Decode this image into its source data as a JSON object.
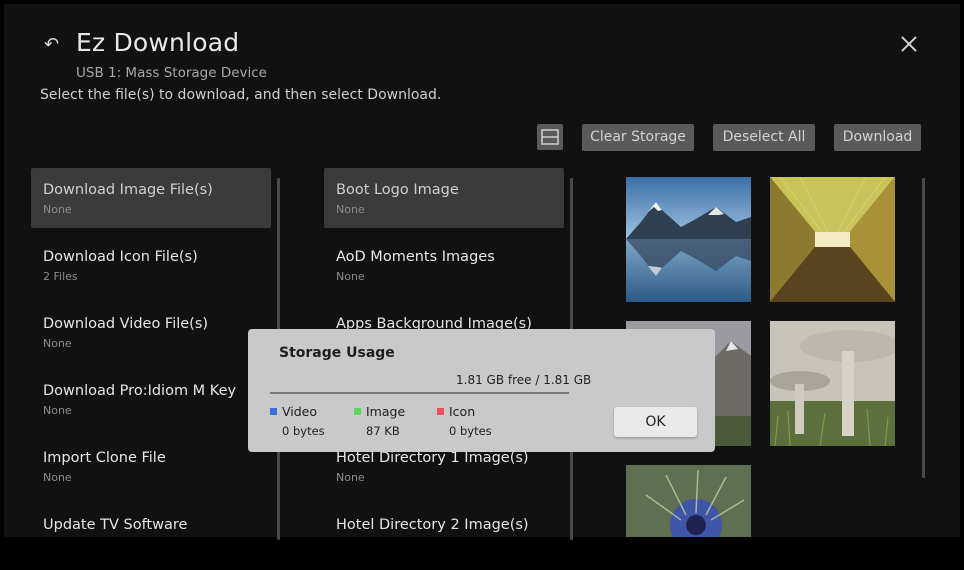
{
  "header": {
    "title": "Ez Download",
    "subtitle": "USB 1: Mass Storage Device",
    "instruction": "Select the file(s) to download, and then select Download."
  },
  "toolbar": {
    "clear_storage": "Clear Storage",
    "deselect_all": "Deselect All",
    "download": "Download"
  },
  "categories": [
    {
      "label": "Download Image File(s)",
      "sub": "None",
      "selected": true
    },
    {
      "label": "Download Icon File(s)",
      "sub": "2 Files"
    },
    {
      "label": "Download Video File(s)",
      "sub": "None"
    },
    {
      "label": "Download Pro:Idiom M Key",
      "sub": "None"
    },
    {
      "label": "Import Clone File",
      "sub": "None"
    },
    {
      "label": "Update TV Software",
      "sub": ""
    }
  ],
  "image_types": [
    {
      "label": "Boot Logo Image",
      "sub": "None",
      "selected": true
    },
    {
      "label": "AoD Moments Images",
      "sub": "None"
    },
    {
      "label": "Apps Background Image(s)",
      "sub": ""
    },
    {
      "label": "",
      "sub": ""
    },
    {
      "label": "Hotel Directory 1 Image(s)",
      "sub": "None"
    },
    {
      "label": "Hotel Directory 2 Image(s)",
      "sub": ""
    }
  ],
  "thumbnails": [
    {
      "name": "mountain-lake-thumbnail"
    },
    {
      "name": "tunnel-thumbnail"
    },
    {
      "name": "rocky-mountains-thumbnail"
    },
    {
      "name": "mushroom-thumbnail"
    },
    {
      "name": "flower-thumbnail"
    }
  ],
  "dialog": {
    "title": "Storage Usage",
    "free_text": "1.81 GB free / 1.81 GB",
    "legend": [
      {
        "label": "Video",
        "value": "0 bytes",
        "color": "#3b6fe0"
      },
      {
        "label": "Image",
        "value": "87 KB",
        "color": "#5fd35f"
      },
      {
        "label": "Icon",
        "value": "0 bytes",
        "color": "#e8535c"
      }
    ],
    "ok": "OK"
  }
}
